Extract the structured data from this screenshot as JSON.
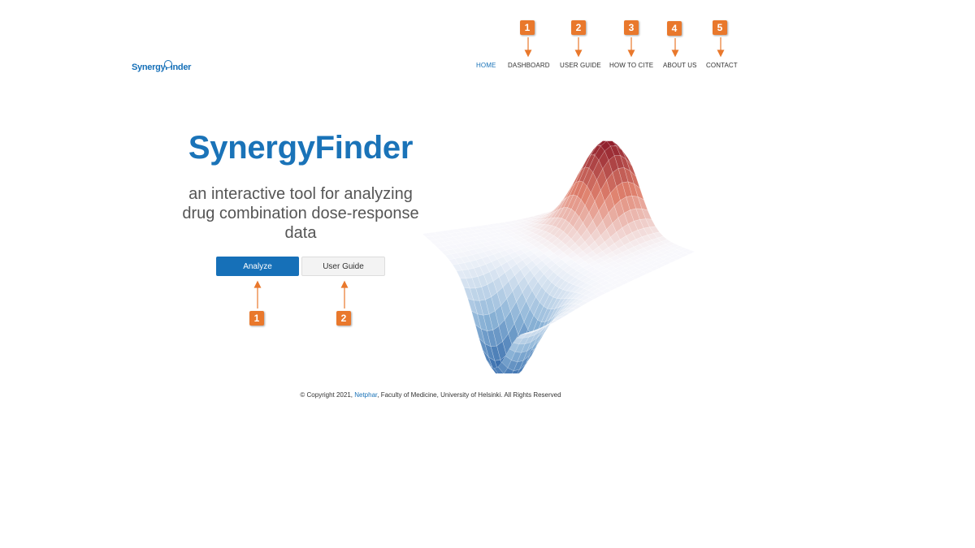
{
  "logo": {
    "text": "SynergyFinder"
  },
  "nav": {
    "items": [
      {
        "label": "HOME",
        "active": true
      },
      {
        "label": "DASHBOARD",
        "active": false
      },
      {
        "label": "USER GUIDE",
        "active": false
      },
      {
        "label": "HOW TO CITE",
        "active": false
      },
      {
        "label": "ABOUT US",
        "active": false
      },
      {
        "label": "CONTACT",
        "active": false
      }
    ]
  },
  "nav_markers": [
    "1",
    "2",
    "3",
    "4",
    "5"
  ],
  "hero": {
    "title": "SynergyFinder",
    "subtitle": "an interactive tool for analyzing drug combination dose-response data",
    "buttons": {
      "analyze_label": "Analyze",
      "user_guide_label": "User Guide"
    }
  },
  "button_markers": [
    "1",
    "2"
  ],
  "footer": {
    "prefix": "© Copyright 2021, ",
    "link": "Netphar",
    "suffix": ", Faculty of Medicine, University of Helsinki. All Rights Reserved"
  },
  "colors": {
    "brand_blue": "#1670b8",
    "marker_orange": "#e9782c",
    "surface_high": "#8e1c2a",
    "surface_low": "#2a62a6"
  },
  "icons": {
    "logo": "magnifier-logo-icon",
    "surface": "synergy-surface-plot"
  }
}
